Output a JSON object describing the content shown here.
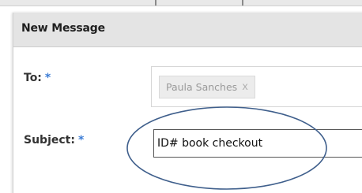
{
  "dialog": {
    "title": "New Message"
  },
  "fields": {
    "to": {
      "label": "To:",
      "required_marker": "*",
      "recipients": [
        {
          "name": "Paula Sanches",
          "remove_glyph": "x"
        }
      ]
    },
    "subject": {
      "label": "Subject:",
      "required_marker": "*",
      "value": "ID# book checkout"
    }
  },
  "colors": {
    "required_marker": "#3a7bd5",
    "annotation_ellipse": "#3f5f8c",
    "header_background": "#e4e4e4"
  }
}
